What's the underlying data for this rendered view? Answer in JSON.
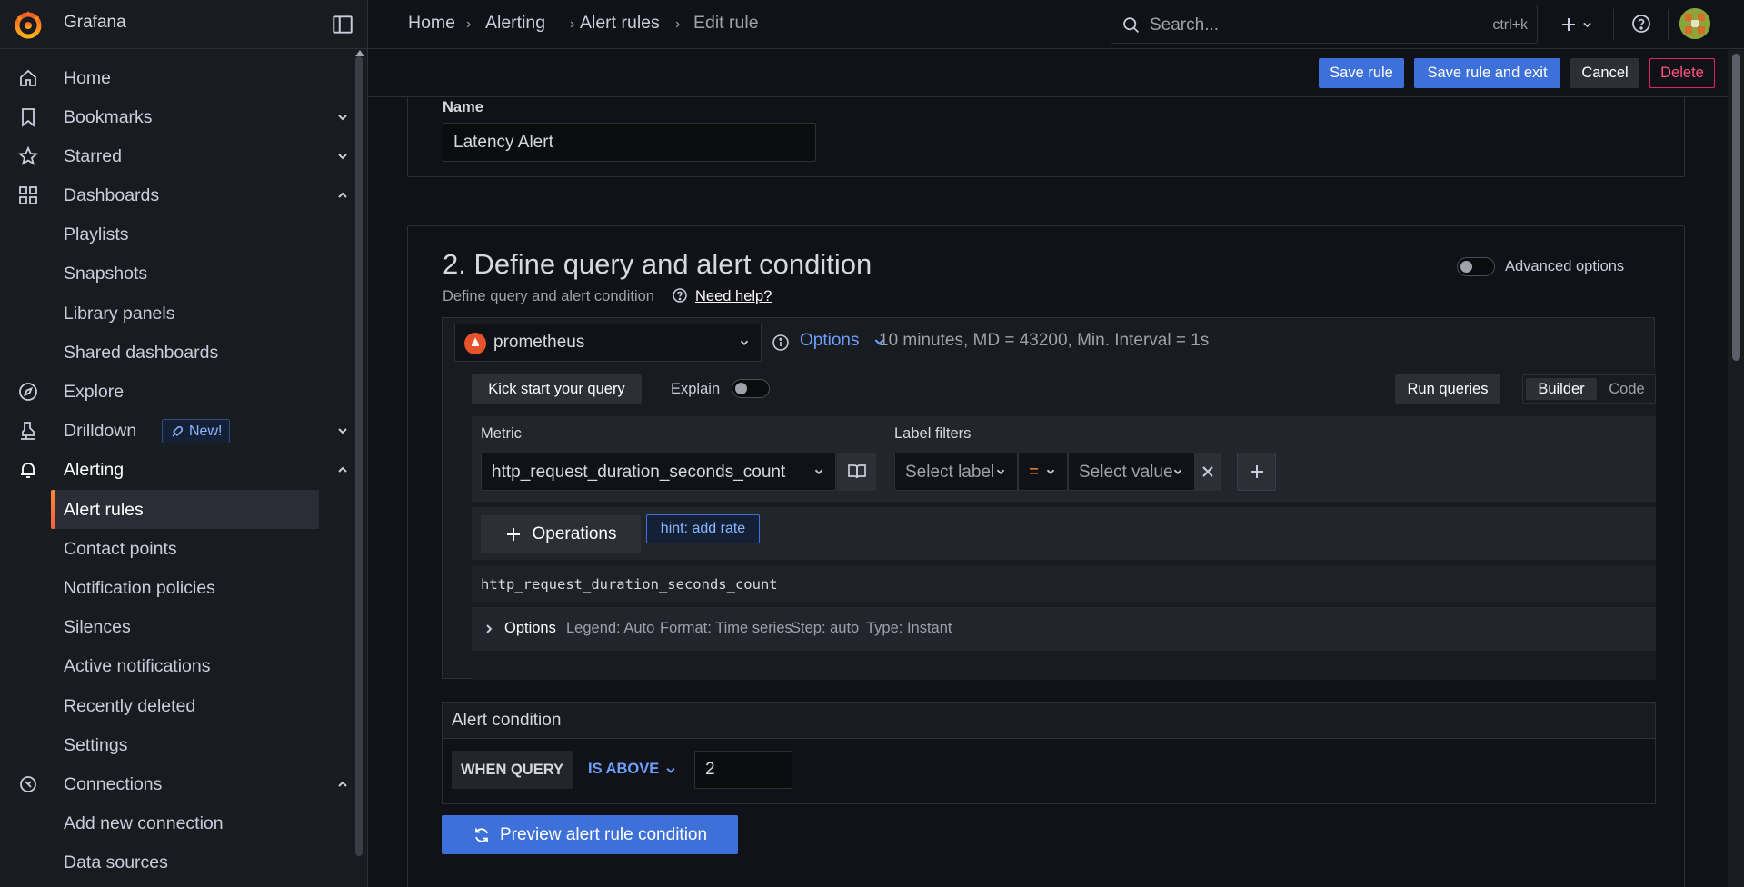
{
  "app": {
    "name": "Grafana"
  },
  "sidebar": {
    "items": [
      {
        "label": "Home",
        "icon": "home-icon"
      },
      {
        "label": "Bookmarks",
        "icon": "bookmark-icon"
      },
      {
        "label": "Starred",
        "icon": "star-icon"
      },
      {
        "label": "Dashboards",
        "icon": "apps-icon"
      },
      {
        "label": "Playlists"
      },
      {
        "label": "Snapshots"
      },
      {
        "label": "Library panels"
      },
      {
        "label": "Shared dashboards"
      },
      {
        "label": "Explore",
        "icon": "compass-icon"
      },
      {
        "label": "Drilldown",
        "icon": "drilldown-icon",
        "badge": "New!"
      },
      {
        "label": "Alerting",
        "icon": "bell-icon"
      },
      {
        "label": "Alert rules"
      },
      {
        "label": "Contact points"
      },
      {
        "label": "Notification policies"
      },
      {
        "label": "Silences"
      },
      {
        "label": "Active notifications"
      },
      {
        "label": "Recently deleted"
      },
      {
        "label": "Settings"
      },
      {
        "label": "Connections",
        "icon": "connections-icon"
      },
      {
        "label": "Add new connection"
      },
      {
        "label": "Data sources"
      }
    ]
  },
  "breadcrumb": [
    "Home",
    "Alerting",
    "Alert rules",
    "Edit rule"
  ],
  "search": {
    "placeholder": "Search...",
    "shortcut": "ctrl+k"
  },
  "toolbar": {
    "save": "Save rule",
    "save_exit": "Save rule and exit",
    "cancel": "Cancel",
    "delete": "Delete"
  },
  "name_section": {
    "label": "Name",
    "value": "Latency Alert"
  },
  "query_section": {
    "title": "2. Define query and alert condition",
    "subtitle": "Define query and alert condition",
    "help_link": "Need help?",
    "advanced_label": "Advanced options",
    "datasource": "prometheus",
    "options_label": "Options",
    "options_summary": "10 minutes, MD = 43200, Min. Interval = 1s",
    "kick_start": "Kick start your query",
    "explain": "Explain",
    "run_queries": "Run queries",
    "mode_builder": "Builder",
    "mode_code": "Code",
    "metric_label": "Metric",
    "metric_value": "http_request_duration_seconds_count",
    "label_filters_label": "Label filters",
    "select_label": "Select label",
    "operator": "=",
    "select_value": "Select value",
    "operations": "Operations",
    "hint": "hint: add rate",
    "query_preview": "http_request_duration_seconds_count",
    "opt_title": "Options",
    "opt_legend": "Legend: Auto",
    "opt_format": "Format: Time series",
    "opt_step": "Step: auto",
    "opt_type": "Type: Instant"
  },
  "alert_condition": {
    "title": "Alert condition",
    "when_query": "WHEN QUERY",
    "is_above": "IS ABOVE",
    "threshold": "2",
    "preview_button": "Preview alert rule condition"
  },
  "colors": {
    "primary": "#3d71d9",
    "accent": "#ff8833",
    "danger": "#ff5286",
    "link": "#6e9fff"
  }
}
